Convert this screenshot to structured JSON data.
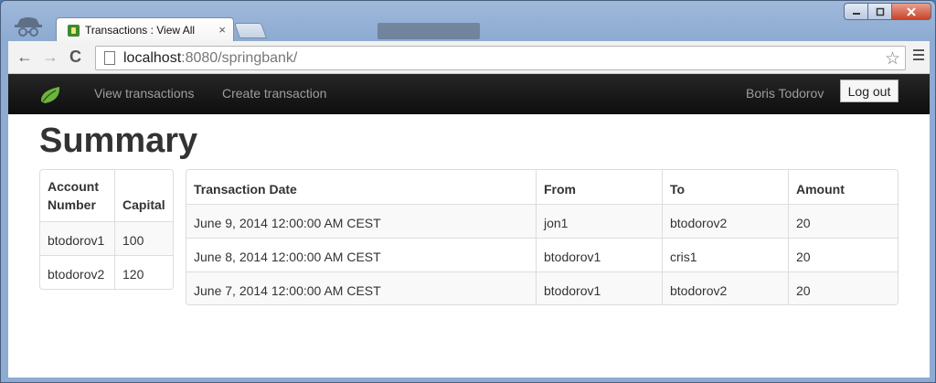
{
  "browser": {
    "tab_title": "Transactions : View All",
    "tab_close": "×",
    "url_host": "localhost",
    "url_rest": ":8080/springbank/",
    "back": "←",
    "forward": "→",
    "reload": "C",
    "star": "☆"
  },
  "navbar": {
    "links": [
      "View transactions",
      "Create transaction"
    ],
    "user": "Boris Todorov",
    "logout": "Log out"
  },
  "page": {
    "title": "Summary"
  },
  "accounts": {
    "headers": [
      "Account Number",
      "Capital"
    ],
    "rows": [
      [
        "btodorov1",
        "100"
      ],
      [
        "btodorov2",
        "120"
      ]
    ]
  },
  "transactions": {
    "headers": [
      "Transaction Date",
      "From",
      "To",
      "Amount"
    ],
    "rows": [
      [
        "June 9, 2014 12:00:00 AM CEST",
        "jon1",
        "btodorov2",
        "20"
      ],
      [
        "June 8, 2014 12:00:00 AM CEST",
        "btodorov1",
        "cris1",
        "20"
      ],
      [
        "June 7, 2014 12:00:00 AM CEST",
        "btodorov1",
        "btodorov2",
        "20"
      ]
    ]
  }
}
